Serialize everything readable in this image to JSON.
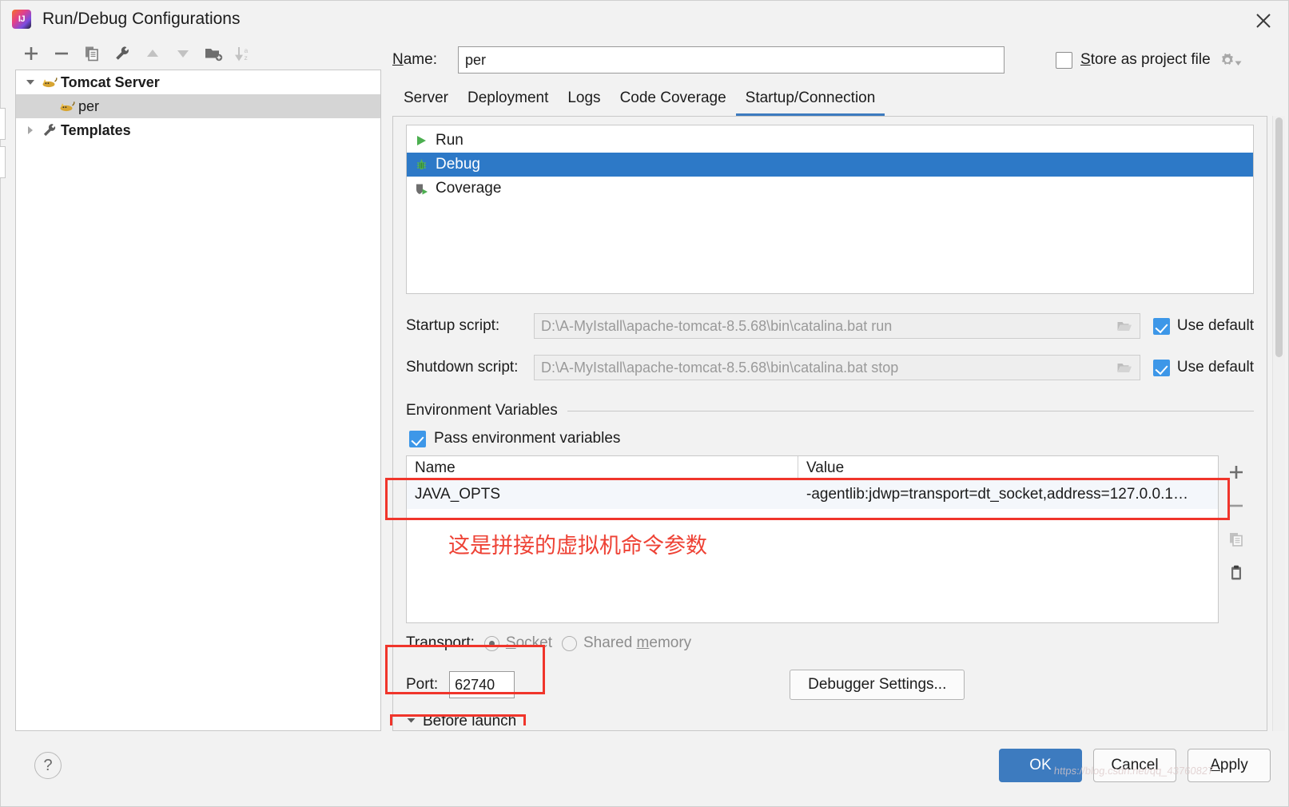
{
  "window": {
    "title": "Run/Debug Configurations",
    "logo_icon": "intellij-idea-logo-icon",
    "close_icon": "close-icon"
  },
  "tree_toolbar": {
    "buttons": [
      {
        "name": "add-configuration-button",
        "icon": "plus-icon",
        "tooltip": "Add New Configuration"
      },
      {
        "name": "remove-configuration-button",
        "icon": "minus-icon",
        "tooltip": "Remove Configuration"
      },
      {
        "name": "copy-configuration-button",
        "icon": "copy-icon",
        "tooltip": "Copy Configuration"
      },
      {
        "name": "edit-templates-button",
        "icon": "wrench-icon",
        "tooltip": "Edit Templates"
      },
      {
        "name": "move-up-button",
        "icon": "arrow-up-icon",
        "tooltip": "Move Up"
      },
      {
        "name": "move-down-button",
        "icon": "arrow-down-icon",
        "tooltip": "Move Down"
      },
      {
        "name": "new-folder-button",
        "icon": "folder-add-icon",
        "tooltip": "Create New Folder"
      },
      {
        "name": "sort-configurations-button",
        "icon": "sort-alpha-icon",
        "tooltip": "Sort Configurations"
      }
    ]
  },
  "tree": {
    "items": [
      {
        "label": "Tomcat Server",
        "icon": "tomcat-cat-icon",
        "twisty": "expanded",
        "bold": true,
        "level": 0,
        "selected": false
      },
      {
        "label": "per",
        "icon": "tomcat-cat-icon",
        "twisty": "none",
        "bold": false,
        "level": 1,
        "selected": true
      },
      {
        "label": "Templates",
        "icon": "wrench-icon",
        "twisty": "collapsed",
        "bold": true,
        "level": 0,
        "selected": false
      }
    ]
  },
  "name_field": {
    "label": "Name:",
    "label_mnemonic": "N",
    "value": "per",
    "placeholder": "Configuration name"
  },
  "store_as_project_file": {
    "label": "Store as project file",
    "label_mnemonic": "S",
    "checked": false,
    "gear_icon": "gear-dropdown-icon"
  },
  "tabs": [
    {
      "label": "Server",
      "active": false
    },
    {
      "label": "Deployment",
      "active": false
    },
    {
      "label": "Logs",
      "active": false
    },
    {
      "label": "Code Coverage",
      "active": false
    },
    {
      "label": "Startup/Connection",
      "active": true
    }
  ],
  "mode_list": [
    {
      "label": "Run",
      "icon": "run-play-icon",
      "selected": false
    },
    {
      "label": "Debug",
      "icon": "debug-bug-icon",
      "selected": true
    },
    {
      "label": "Coverage",
      "icon": "coverage-shield-icon",
      "selected": false
    }
  ],
  "scripts": [
    {
      "label": "Startup script:",
      "value": "D:\\A-MyIstall\\apache-tomcat-8.5.68\\bin\\catalina.bat run",
      "browse_icon": "folder-open-icon",
      "use_default_label": "Use default",
      "use_default_checked": true,
      "disabled": true
    },
    {
      "label": "Shutdown script:",
      "value": "D:\\A-MyIstall\\apache-tomcat-8.5.68\\bin\\catalina.bat stop",
      "browse_icon": "folder-open-icon",
      "use_default_label": "Use default",
      "use_default_checked": true,
      "disabled": true
    }
  ],
  "environment_variables": {
    "legend": "Environment Variables",
    "pass_env_label": "Pass environment variables",
    "pass_env_checked": true,
    "columns": [
      "Name",
      "Value"
    ],
    "rows": [
      {
        "name": "JAVA_OPTS",
        "value": "-agentlib:jdwp=transport=dt_socket,address=127.0.0.1…",
        "selected": true
      }
    ],
    "annotation": "这是拼接的虚拟机命令参数",
    "annotation_color": "#ee4235",
    "sidebar_buttons": [
      {
        "name": "add-env-variable-button",
        "icon": "plus-icon"
      },
      {
        "name": "remove-env-variable-button",
        "icon": "minus-icon"
      },
      {
        "name": "copy-env-variable-button",
        "icon": "copy-icon"
      },
      {
        "name": "paste-env-variable-button",
        "icon": "clipboard-paste-icon"
      }
    ]
  },
  "transport": {
    "label": "Transport:",
    "options": [
      {
        "label": "Socket",
        "mnemonic": "S",
        "selected": true,
        "disabled": true
      },
      {
        "label": "Shared memory",
        "mnemonic": "m",
        "selected": false,
        "disabled": true
      }
    ]
  },
  "port": {
    "label": "Port:",
    "value": "62740"
  },
  "debugger_settings_button": {
    "label": "Debugger Settings..."
  },
  "before_launch": {
    "label": "Before launch",
    "twisty": "expanded"
  },
  "footer": {
    "help_label": "?",
    "buttons": [
      {
        "label": "OK",
        "name": "ok-button",
        "primary": true,
        "mnemonic": ""
      },
      {
        "label": "Cancel",
        "name": "cancel-button",
        "primary": false,
        "mnemonic": ""
      },
      {
        "label": "Apply",
        "name": "apply-button",
        "primary": false,
        "mnemonic": "A"
      }
    ]
  },
  "watermark": "https://blog.csdn.net/qq_43760827",
  "colors": {
    "accent_blue": "#3d7bbf",
    "selection_blue": "#2d79c7",
    "checkbox_blue": "#3d97e8",
    "annotation_red": "#f0352b",
    "panel_gray": "#f2f2f2",
    "disabled_text": "#9a9a9a"
  }
}
